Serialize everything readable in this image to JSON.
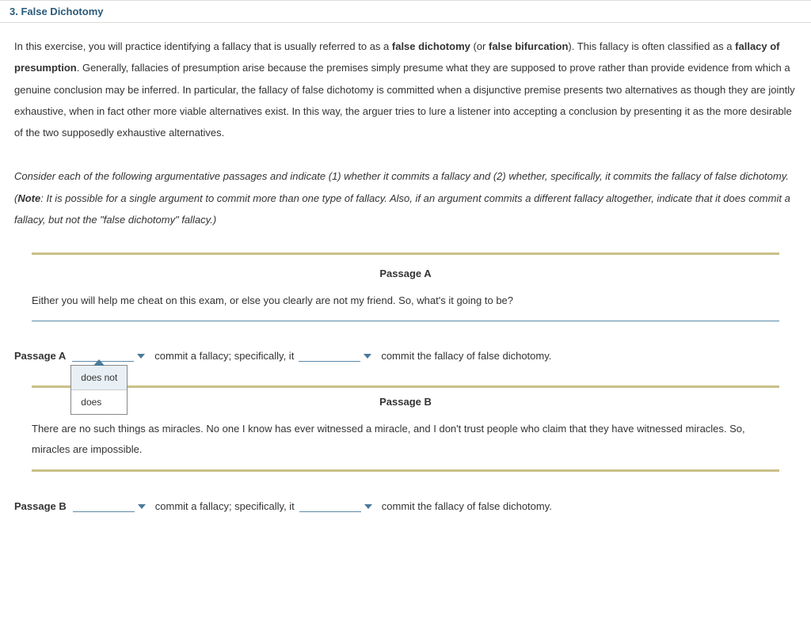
{
  "header": {
    "title": "3. False Dichotomy"
  },
  "intro": {
    "part1": "In this exercise, you will practice identifying a fallacy that is usually referred to as a ",
    "bold1": "false dichotomy",
    "part2": " (or ",
    "bold2": "false bifurcation",
    "part3": "). This fallacy is often classified as a ",
    "bold3": "fallacy of presumption",
    "part4": ". Generally, fallacies of presumption arise because the premises simply presume what they are supposed to prove rather than provide evidence from which a genuine conclusion may be inferred. In particular, the fallacy of false dichotomy is committed when a disjunctive premise presents two alternatives as though they are jointly exhaustive, when in fact other more viable alternatives exist. In this way, the arguer tries to lure a listener into accepting a conclusion by presenting it as the more desirable of the two supposedly exhaustive alternatives."
  },
  "instructions": {
    "part1": "Consider each of the following argumentative passages and indicate (1) whether it commits a fallacy and (2) whether, specifically, it commits the fallacy of false dichotomy. (",
    "noteBold": "Note",
    "part2": ": It is possible for a single argument to commit more than one type of fallacy. Also, if an argument commits a different fallacy altogether, indicate that it does commit a fallacy, but not the \"false dichotomy\" fallacy.)"
  },
  "passageA": {
    "title": "Passage A",
    "text": "Either you will help me cheat on this exam, or else you clearly are not my friend. So, what's it going to be?"
  },
  "passageB": {
    "title": "Passage B",
    "text": "There are no such things as miracles. No one I know has ever witnessed a miracle, and I don't trust people who claim that they have witnessed miracles. So, miracles are impossible."
  },
  "answerA": {
    "label": "Passage A",
    "mid": " commit a fallacy; specifically, it ",
    "end": " commit the fallacy of false dichotomy."
  },
  "answerB": {
    "label": "Passage B",
    "mid": " commit a fallacy; specifically, it ",
    "end": " commit the fallacy of false dichotomy."
  },
  "dropdown": {
    "option1": "does not",
    "option2": "does"
  }
}
